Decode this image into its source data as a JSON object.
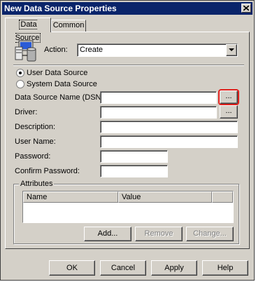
{
  "window": {
    "title": "New Data Source Properties"
  },
  "tabs": [
    {
      "label": "Data Source",
      "active": true
    },
    {
      "label": "Common",
      "active": false
    }
  ],
  "action": {
    "label": "Action:",
    "value": "Create"
  },
  "radio": {
    "user": "User Data Source",
    "system": "System Data Source",
    "selected": "user"
  },
  "fields": {
    "dsn": {
      "label": "Data Source Name (DSN):",
      "value": ""
    },
    "driver": {
      "label": "Driver:",
      "value": ""
    },
    "description": {
      "label": "Description:",
      "value": ""
    },
    "username": {
      "label": "User Name:",
      "value": ""
    },
    "password": {
      "label": "Password:",
      "value": ""
    },
    "confirm_password": {
      "label": "Confirm Password:",
      "value": ""
    }
  },
  "browse_label": "...",
  "attributes": {
    "title": "Attributes",
    "columns": [
      "Name",
      "Value"
    ],
    "rows": [],
    "buttons": {
      "add": "Add...",
      "remove": "Remove",
      "change": "Change..."
    }
  },
  "footer": {
    "ok": "OK",
    "cancel": "Cancel",
    "apply": "Apply",
    "help": "Help"
  },
  "colors": {
    "titlebar": "#0a246a",
    "face": "#d4d0c8",
    "highlight_ring": "#e0201c"
  }
}
